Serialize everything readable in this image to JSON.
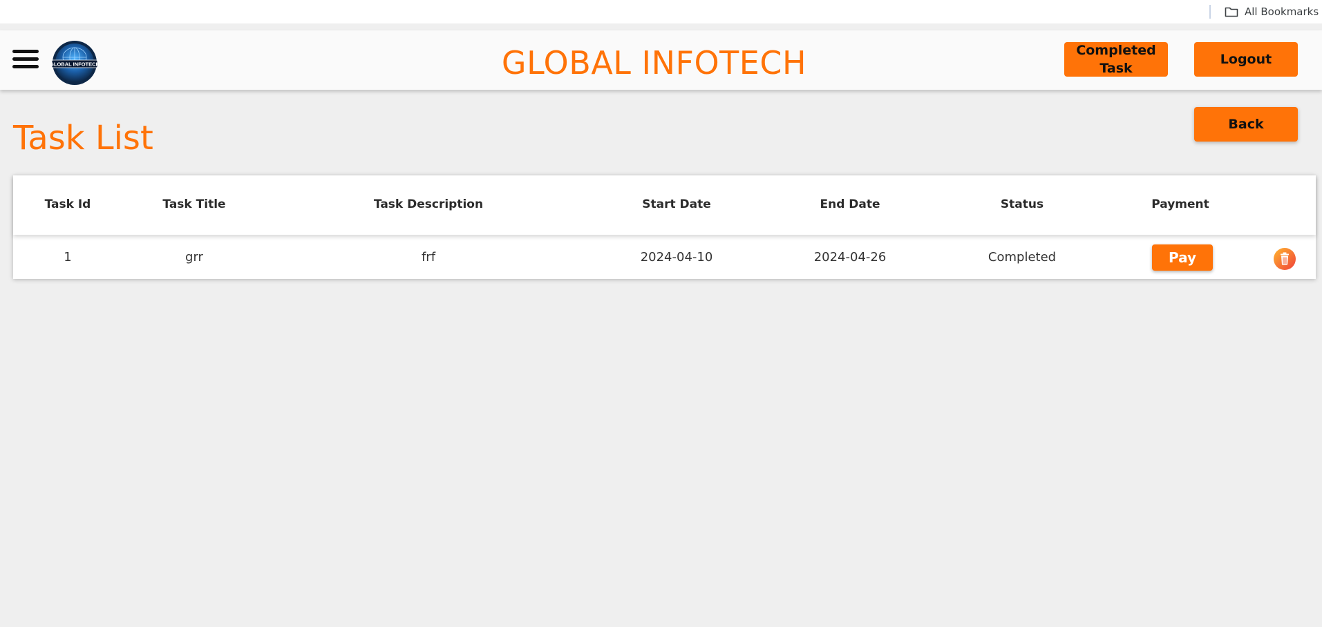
{
  "bookmarks_bar": {
    "folder_label": "All Bookmarks",
    "folder_icon": "folder-icon"
  },
  "header": {
    "menu_icon": "hamburger-menu-icon",
    "logo_text": "GLOBAL INFOTECH",
    "title": "GLOBAL INFOTECH",
    "completed_task_line1": "Completed",
    "completed_task_line2": "Task",
    "logout_label": "Logout"
  },
  "page": {
    "title": "Task List",
    "back_label": "Back"
  },
  "table": {
    "columns": [
      "Task Id",
      "Task Title",
      "Task Description",
      "Start Date",
      "End Date",
      "Status",
      "Payment"
    ],
    "rows": [
      {
        "task_id": "1",
        "task_title": "grr",
        "task_description": "frf",
        "start_date": "2024-04-10",
        "end_date": "2024-04-26",
        "status": "Completed",
        "pay_label": "Pay",
        "delete_icon": "trash-icon"
      }
    ]
  },
  "colors": {
    "accent": "#ff7308",
    "background": "#efefef",
    "header_bg": "#fafafa"
  }
}
